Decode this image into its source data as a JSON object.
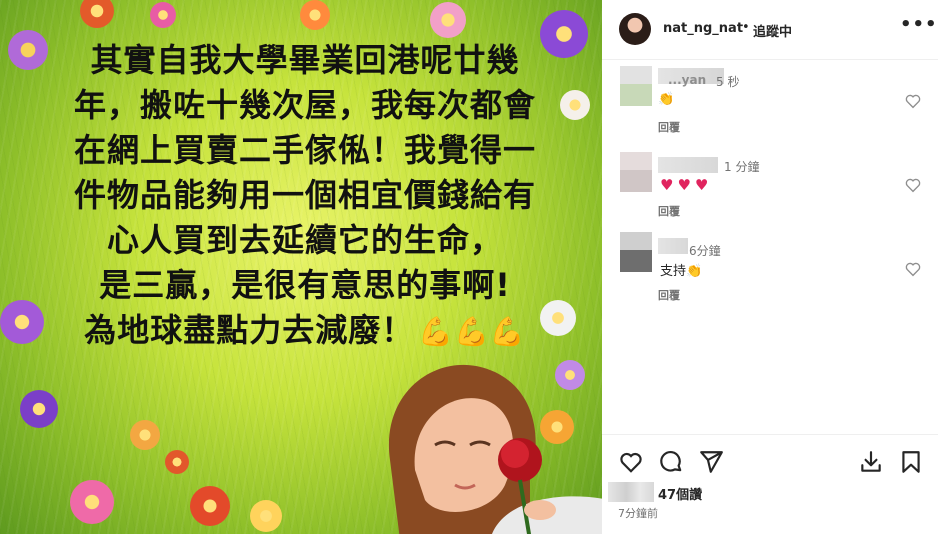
{
  "post": {
    "quote_lines": [
      "其實自我大學畢業回港呢廿幾",
      "年，搬咗十幾次屋，我每次都會",
      "在網上買賣二手傢俬！我覺得一",
      "件物品能夠用一個相宜價錢給有",
      "心人買到去延續它的生命，",
      "是三贏，是很有意思的事啊!",
      "為地球盡點力去減廢！"
    ],
    "quote_emoji": "💪💪💪"
  },
  "header": {
    "username": "nat_ng_nat",
    "separator": "•",
    "follow_label": "追蹤中",
    "more_label": "•••"
  },
  "comments": [
    {
      "name_fragment": "...yan",
      "time": "5 秒",
      "text": "👏",
      "reply_label": "回覆"
    },
    {
      "time": "1 分鐘",
      "text": "♥♥♥",
      "reply_label": "回覆"
    },
    {
      "time": "6分鐘",
      "text": "支持👏",
      "reply_label": "回覆"
    }
  ],
  "actions": {
    "like_icon": "heart-outline-icon",
    "comment_icon": "comment-bubble-icon",
    "share_icon": "send-icon",
    "download_icon": "download-icon",
    "save_icon": "bookmark-icon"
  },
  "stats": {
    "likes": "47個讚",
    "posted": "7分鐘前"
  },
  "colors": {
    "heart_red": "#e0245e",
    "muted_text": "#737373",
    "text": "#262626"
  }
}
